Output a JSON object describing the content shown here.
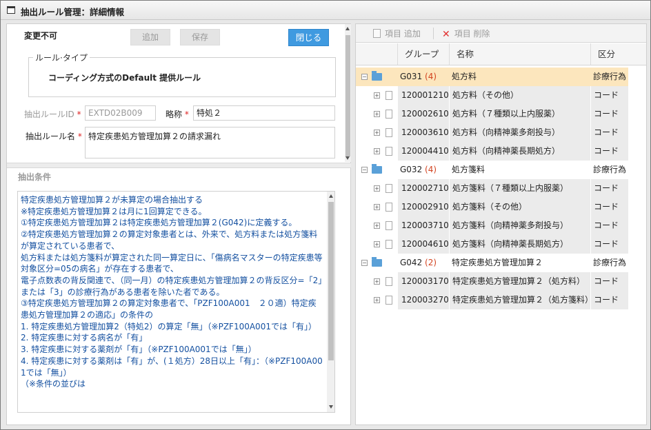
{
  "window": {
    "title": "抽出ルール管理：詳細情報"
  },
  "form": {
    "fixed_label": "変更不可",
    "add_label": "追加",
    "save_label": "保存",
    "close_label": "閉じる",
    "rule_type_legend": "ルール·タイプ",
    "rule_type_value": "コーディング方式のDefault 提供ルール",
    "rule_id_label": "抽出ルールID",
    "rule_id_value": "EXTD02B009",
    "short_label": "略称",
    "short_value": "特処２",
    "rule_name_label": "抽出ルール名",
    "rule_name_value": "特定疾患処方管理加算２の請求漏れ",
    "required_mark": "*"
  },
  "conditions": {
    "title": "抽出条件",
    "text": "特定疾患処方管理加算２が未算定の場合抽出する\n※特定疾患処方管理加算２は月に1回算定できる。\n①特定疾患処方管理加算２は特定疾患処方管理加算２(G042)に定義する。\n②特定疾患処方管理加算２の算定対象患者とは、外来で、処方料または処方箋料が算定されている患者で、\n処方料または処方箋料が算定された同一算定日に、「傷病名マスターの特定疾患等対象区分=05の病名」が存在する患者で、\n電子点数表の背反関連で、（同一月）の特定疾患処方管理加算２の背反区分=「2」または「3」の診療行為がある患者を除いた者である。\n③特定疾患処方管理加算２の算定対象患者で、「PZF100A001　２０適）特定疾患処方管理加算２の適応」の条件の\n1. 特定疾患処方管理加算2（特処2）の算定「無」（※PZF100A001では「有」）\n2. 特定疾患に対する病名が「有」\n3. 特定疾患に対する薬剤が「有」（※PZF100A001では「無」）\n4. 特定疾患に対する薬剤は「有」が、(１処方）28日以上「有」：（※PZF100A001では「無」）\n（※条件の並びは"
  },
  "toolbar": {
    "add_item_label": "項目 追加",
    "delete_item_label": "項目 削除"
  },
  "grid": {
    "headers": [
      "グループ",
      "名称",
      "区分"
    ],
    "rows": [
      {
        "code": "G031",
        "count": "(4)",
        "name": "処方料",
        "kind": "診療行為",
        "group": true,
        "selected": true
      },
      {
        "code": "120001210",
        "name": "処方料（その他）",
        "kind": "コード"
      },
      {
        "code": "120002610",
        "name": "処方料（７種類以上内服薬）",
        "kind": "コード"
      },
      {
        "code": "120003610",
        "name": "処方料（向精神薬多剤投与）",
        "kind": "コード"
      },
      {
        "code": "120004410",
        "name": "処方料（向精神薬長期処方）",
        "kind": "コード"
      },
      {
        "code": "G032",
        "count": "(4)",
        "name": "処方箋料",
        "kind": "診療行為",
        "group": true
      },
      {
        "code": "120002710",
        "name": "処方箋料（７種類以上内服薬）",
        "kind": "コード"
      },
      {
        "code": "120002910",
        "name": "処方箋料（その他）",
        "kind": "コード"
      },
      {
        "code": "120003710",
        "name": "処方箋料（向精神薬多剤投与）",
        "kind": "コード"
      },
      {
        "code": "120004610",
        "name": "処方箋料（向精神薬長期処方）",
        "kind": "コード"
      },
      {
        "code": "G042",
        "count": "(2)",
        "name": "特定疾患処方管理加算２",
        "kind": "診療行為",
        "group": true
      },
      {
        "code": "120003170",
        "name": "特定疾患処方管理加算２（処方料）",
        "kind": "コード"
      },
      {
        "code": "120003270",
        "name": "特定疾患処方管理加算２（処方箋料）",
        "kind": "コード"
      }
    ]
  }
}
